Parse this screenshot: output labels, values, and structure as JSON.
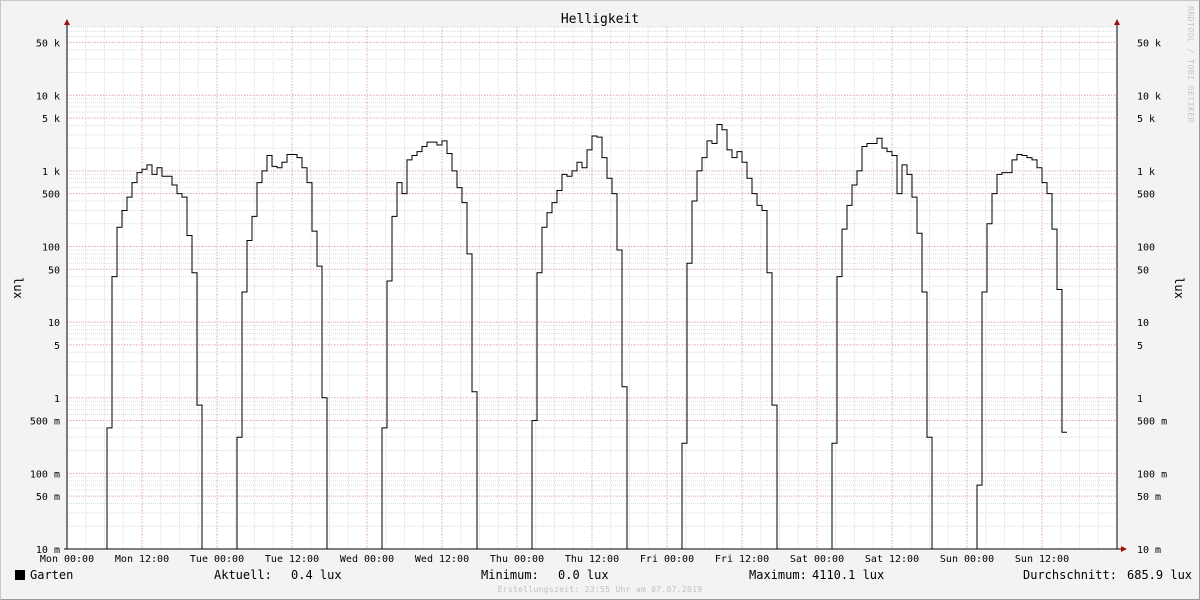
{
  "watermark": "RRDTOOL / TOBI OETIKER",
  "chart_data": {
    "type": "line",
    "title": "Helligkeit",
    "ylabel": "lux",
    "yscale": "log",
    "ylim": [
      0.01,
      80000
    ],
    "yticks": [
      {
        "v": 50000,
        "label": "50 k"
      },
      {
        "v": 10000,
        "label": "10 k"
      },
      {
        "v": 5000,
        "label": "5 k"
      },
      {
        "v": 1000,
        "label": "1 k"
      },
      {
        "v": 500,
        "label": "500"
      },
      {
        "v": 100,
        "label": "100"
      },
      {
        "v": 50,
        "label": "50"
      },
      {
        "v": 10,
        "label": "10"
      },
      {
        "v": 5,
        "label": "5"
      },
      {
        "v": 1,
        "label": "1"
      },
      {
        "v": 0.5,
        "label": "500 m"
      },
      {
        "v": 0.1,
        "label": "100 m"
      },
      {
        "v": 0.05,
        "label": "50 m"
      },
      {
        "v": 0.01,
        "label": "10 m"
      }
    ],
    "xlim_hours": [
      0,
      168
    ],
    "xticks": [
      {
        "h": 0,
        "label": "Mon 00:00"
      },
      {
        "h": 12,
        "label": "Mon 12:00"
      },
      {
        "h": 24,
        "label": "Tue 00:00"
      },
      {
        "h": 36,
        "label": "Tue 12:00"
      },
      {
        "h": 48,
        "label": "Wed 00:00"
      },
      {
        "h": 60,
        "label": "Wed 12:00"
      },
      {
        "h": 72,
        "label": "Thu 00:00"
      },
      {
        "h": 84,
        "label": "Thu 12:00"
      },
      {
        "h": 96,
        "label": "Fri 00:00"
      },
      {
        "h": 108,
        "label": "Fri 12:00"
      },
      {
        "h": 120,
        "label": "Sat 00:00"
      },
      {
        "h": 132,
        "label": "Sat 12:00"
      },
      {
        "h": 144,
        "label": "Sun 00:00"
      },
      {
        "h": 156,
        "label": "Sun 12:00"
      }
    ],
    "grid": true,
    "series": [
      {
        "name": "Garten",
        "color": "#000000",
        "step_hours": 0.8,
        "start_hour": 0,
        "values": [
          0.01,
          0.01,
          0.01,
          0.01,
          0.01,
          0.01,
          0.01,
          0.01,
          0.4,
          40,
          180,
          300,
          450,
          700,
          950,
          1050,
          1200,
          900,
          1100,
          850,
          850,
          650,
          500,
          450,
          140,
          45,
          0.8,
          0.01,
          0.01,
          0.01,
          0.01,
          0.01,
          0.01,
          0.01,
          0.3,
          25,
          120,
          250,
          700,
          1000,
          1600,
          1150,
          1100,
          1300,
          1650,
          1650,
          1500,
          1100,
          700,
          160,
          55,
          1,
          0.01,
          0.01,
          0.01,
          0.01,
          0.01,
          0.01,
          0.01,
          0.01,
          0.01,
          0.01,
          0.01,
          0.4,
          35,
          250,
          700,
          500,
          1400,
          1600,
          1800,
          2100,
          2400,
          2400,
          2200,
          2500,
          1700,
          1000,
          600,
          380,
          80,
          1.2,
          0.01,
          0.01,
          0.01,
          0.01,
          0.01,
          0.01,
          0.01,
          0.01,
          0.01,
          0.01,
          0.01,
          0.5,
          45,
          180,
          280,
          380,
          550,
          900,
          850,
          1000,
          1300,
          1100,
          1900,
          2900,
          2800,
          1500,
          800,
          500,
          90,
          1.4,
          0.01,
          0.01,
          0.01,
          0.01,
          0.01,
          0.01,
          0.01,
          0.01,
          0.01,
          0.01,
          0.01,
          0.25,
          60,
          400,
          1000,
          1500,
          2500,
          2300,
          4110,
          3500,
          1900,
          1500,
          1800,
          1300,
          800,
          500,
          350,
          300,
          45,
          0.8,
          0.01,
          0.01,
          0.01,
          0.01,
          0.01,
          0.01,
          0.01,
          0.01,
          0.01,
          0.01,
          0.01,
          0.25,
          40,
          170,
          350,
          650,
          1000,
          2100,
          2300,
          2300,
          2700,
          2000,
          1800,
          1600,
          500,
          1200,
          900,
          450,
          150,
          25,
          0.3,
          0.01,
          0.01,
          0.01,
          0.01,
          0.01,
          0.01,
          0.01,
          0.01,
          0.01,
          0.07,
          25,
          200,
          500,
          900,
          950,
          950,
          1400,
          1650,
          1600,
          1500,
          1400,
          1100,
          700,
          500,
          170,
          27,
          0.35
        ]
      }
    ],
    "legend": {
      "series": "Garten",
      "aktuell_label": "Aktuell:",
      "aktuell": "0.4 lux",
      "minimum_label": "Minimum:",
      "minimum": "0.0 lux",
      "maximum_label": "Maximum:",
      "maximum": "4110.1 lux",
      "durchschnitt_label": "Durchschnitt:",
      "durchschnitt": "685.9 lux"
    },
    "footer": "Erstellungszeit: 23:55 Uhr am 07.07.2019"
  }
}
